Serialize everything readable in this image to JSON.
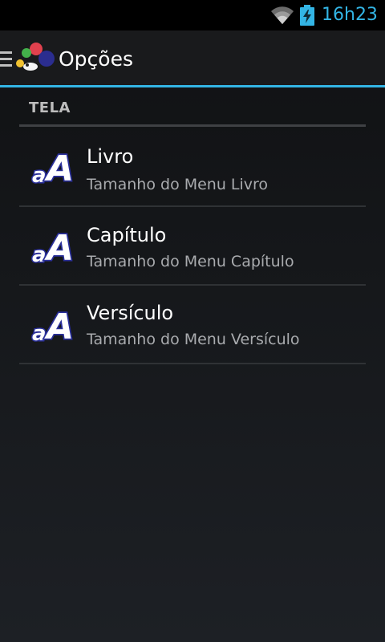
{
  "status_bar": {
    "time": "16h23",
    "icons": [
      "wifi-icon",
      "battery-charging-icon"
    ],
    "accent_color": "#33b5e5"
  },
  "action_bar": {
    "title": "Opções",
    "icons": [
      "drawer-menu-icon",
      "app-logo-icon"
    ],
    "underline_color": "#33b5e5"
  },
  "section": {
    "header": "TELA"
  },
  "items": [
    {
      "title": "Livro",
      "summary": "Tamanho do Menu Livro",
      "icon": "font-size-icon"
    },
    {
      "title": "Capítulo",
      "summary": "Tamanho do Menu Capítulo",
      "icon": "font-size-icon"
    },
    {
      "title": "Versículo",
      "summary": "Tamanho do Menu Versículo",
      "icon": "font-size-icon"
    }
  ]
}
